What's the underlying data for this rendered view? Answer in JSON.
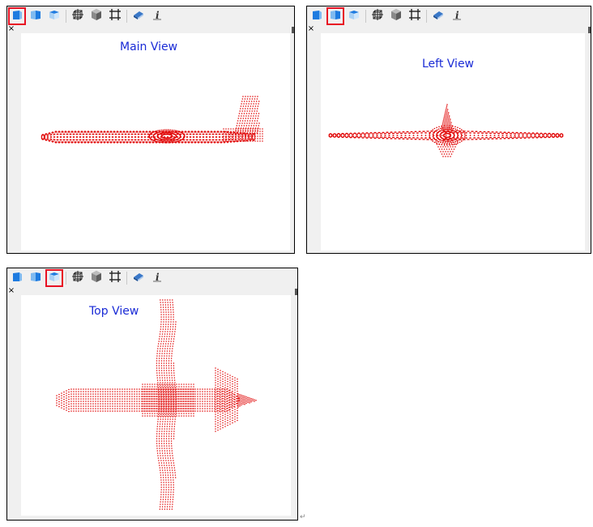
{
  "panels": [
    {
      "id": "main",
      "title": "Main View",
      "selected_tool": 0
    },
    {
      "id": "left",
      "title": "Left View",
      "selected_tool": 1
    },
    {
      "id": "top",
      "title": "Top View",
      "selected_tool": 2
    }
  ],
  "toolbar": {
    "tools": [
      {
        "icon": "front-view-cube-icon"
      },
      {
        "icon": "side-view-cube-icon"
      },
      {
        "icon": "top-view-cube-icon"
      },
      {
        "icon": "wireframe-icon"
      },
      {
        "icon": "solid-shading-icon"
      },
      {
        "icon": "grid-frame-icon"
      },
      {
        "icon": "eraser-icon"
      },
      {
        "icon": "info-icon",
        "label": "i"
      }
    ],
    "close_label": "×"
  },
  "colors": {
    "title": "#1a2bd6",
    "points": "#e00000",
    "selected": "#e81123"
  },
  "paragraph_mark": "↵"
}
